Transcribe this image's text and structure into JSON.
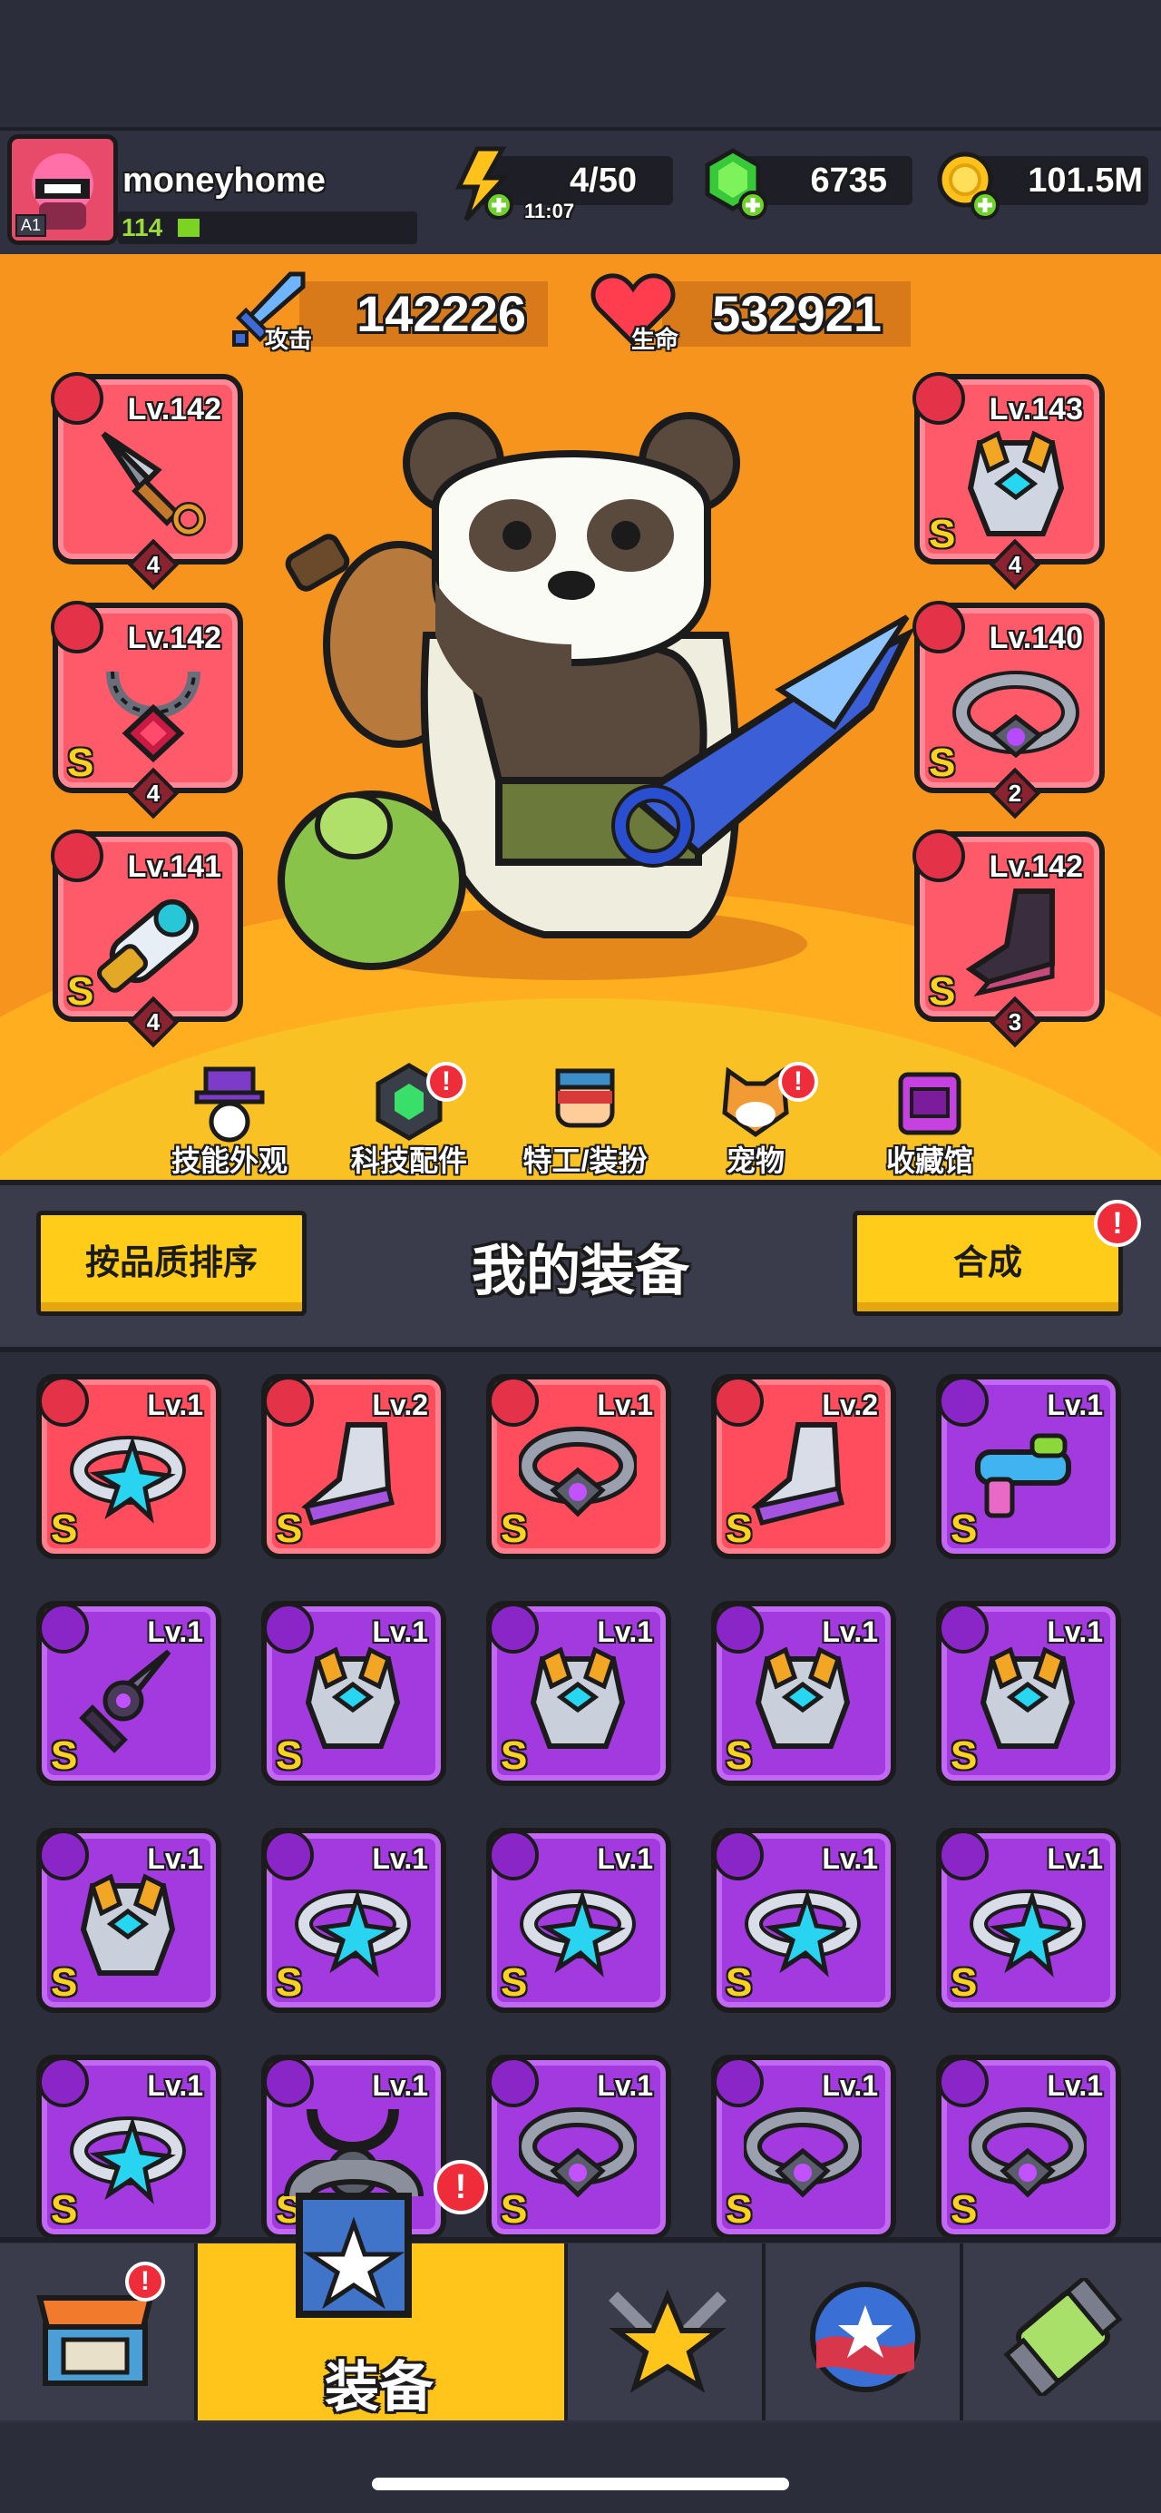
{
  "player": {
    "name": "moneyhome",
    "level": "114",
    "rank_badge": "A1",
    "avatar": "ninja-avatar"
  },
  "resources": {
    "energy": {
      "value": "4/50",
      "timer": "11:07",
      "icon": "lightning-icon"
    },
    "gems": {
      "value": "6735",
      "icon": "gem-icon"
    },
    "coins": {
      "value": "101.5M",
      "icon": "coin-icon"
    }
  },
  "stats": {
    "attack": {
      "label": "攻击",
      "value": "142226"
    },
    "hp": {
      "label": "生命",
      "value": "532921"
    }
  },
  "equipped_left": [
    {
      "level": "Lv.142",
      "stars": "4",
      "rank": "",
      "icon": "kunai-icon"
    },
    {
      "level": "Lv.142",
      "stars": "4",
      "rank": "S",
      "icon": "necklace-icon"
    },
    {
      "level": "Lv.141",
      "stars": "4",
      "rank": "S",
      "icon": "gauntlet-icon"
    }
  ],
  "equipped_right": [
    {
      "level": "Lv.143",
      "stars": "4",
      "rank": "S",
      "icon": "armor-icon"
    },
    {
      "level": "Lv.140",
      "stars": "2",
      "rank": "S",
      "icon": "belt-icon"
    },
    {
      "level": "Lv.142",
      "stars": "3",
      "rank": "S",
      "icon": "boots-icon"
    }
  ],
  "shortcuts": [
    {
      "label": "技能外观",
      "icon": "skill-skin-icon",
      "alert": false
    },
    {
      "label": "科技配件",
      "icon": "tech-parts-icon",
      "alert": true
    },
    {
      "label": "特工/装扮",
      "icon": "agent-icon",
      "alert": false
    },
    {
      "label": "宠物",
      "icon": "pet-icon",
      "alert": true
    },
    {
      "label": "收藏馆",
      "icon": "collection-icon",
      "alert": false
    }
  ],
  "inventory_header": {
    "sort_label": "按品质排序",
    "title": "我的装备",
    "merge_label": "合成"
  },
  "inventory": [
    {
      "level": "Lv.1",
      "rank": "S",
      "quality": "red",
      "icon": "ring-icon"
    },
    {
      "level": "Lv.2",
      "rank": "S",
      "quality": "red",
      "icon": "boots-icon"
    },
    {
      "level": "Lv.1",
      "rank": "S",
      "quality": "red",
      "icon": "belt-icon"
    },
    {
      "level": "Lv.2",
      "rank": "S",
      "quality": "red",
      "icon": "boots-icon"
    },
    {
      "level": "Lv.1",
      "rank": "S",
      "quality": "purple",
      "icon": "gun-icon"
    },
    {
      "level": "Lv.1",
      "rank": "S",
      "quality": "purple",
      "icon": "kunai-icon"
    },
    {
      "level": "Lv.1",
      "rank": "S",
      "quality": "purple",
      "icon": "armor-icon"
    },
    {
      "level": "Lv.1",
      "rank": "S",
      "quality": "purple",
      "icon": "armor-icon"
    },
    {
      "level": "Lv.1",
      "rank": "S",
      "quality": "purple",
      "icon": "armor-icon"
    },
    {
      "level": "Lv.1",
      "rank": "S",
      "quality": "purple",
      "icon": "armor-icon"
    },
    {
      "level": "Lv.1",
      "rank": "S",
      "quality": "purple",
      "icon": "armor-icon"
    },
    {
      "level": "Lv.1",
      "rank": "S",
      "quality": "purple",
      "icon": "ring-icon"
    },
    {
      "level": "Lv.1",
      "rank": "S",
      "quality": "purple",
      "icon": "ring-icon"
    },
    {
      "level": "Lv.1",
      "rank": "S",
      "quality": "purple",
      "icon": "ring-icon"
    },
    {
      "level": "Lv.1",
      "rank": "S",
      "quality": "purple",
      "icon": "ring-icon"
    },
    {
      "level": "Lv.1",
      "rank": "S",
      "quality": "purple",
      "icon": "ring-icon"
    },
    {
      "level": "Lv.1",
      "rank": "S",
      "quality": "purple",
      "icon": "necklace-icon"
    },
    {
      "level": "Lv.1",
      "rank": "S",
      "quality": "purple",
      "icon": "belt-icon"
    },
    {
      "level": "Lv.1",
      "rank": "S",
      "quality": "purple",
      "icon": "belt-icon"
    },
    {
      "level": "Lv.1",
      "rank": "S",
      "quality": "purple",
      "icon": "belt-icon"
    }
  ],
  "nav": {
    "tabs": [
      {
        "label": "",
        "icon": "shop-icon",
        "alert": true
      },
      {
        "label": "装备",
        "icon": "equipment-icon",
        "alert": true,
        "active": true
      },
      {
        "label": "",
        "icon": "talent-star-icon",
        "alert": false
      },
      {
        "label": "",
        "icon": "battle-orb-icon",
        "alert": false
      },
      {
        "label": "",
        "icon": "gene-tube-icon",
        "alert": false
      }
    ]
  },
  "alert_mark": "!",
  "colors": {
    "hero_bg": "#f7941d",
    "red_quality": "#ff4d5d",
    "purple_quality": "#a33ae0",
    "button_yellow": "#ffcc1a"
  }
}
